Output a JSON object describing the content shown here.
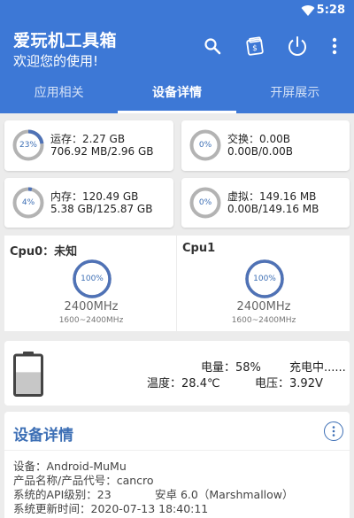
{
  "status_bar": {
    "time": "5:28",
    "wifi_icon": "wifi-icon"
  },
  "app_bar": {
    "title": "爱玩机工具箱",
    "subtitle": "欢迎您的使用!",
    "actions": [
      "search-icon",
      "cleanup-icon",
      "power-icon",
      "more-vert-icon"
    ]
  },
  "tabs": [
    {
      "label": "应用相关",
      "active": false
    },
    {
      "label": "设备详情",
      "active": true
    },
    {
      "label": "开屏展示",
      "active": false
    }
  ],
  "memory": {
    "ram": {
      "label": "运存：",
      "value": "2.27 GB",
      "detail": "706.92 MB/2.96 GB",
      "percent": 23,
      "percent_label": "23%"
    },
    "swap": {
      "label": "交换：",
      "value": "0.00B",
      "detail": "0.00B/0.00B",
      "percent": 0,
      "percent_label": "0%"
    },
    "storage": {
      "label": "内存：",
      "value": "120.49 GB",
      "detail": "5.38 GB/125.87 GB",
      "percent": 4,
      "percent_label": "4%"
    },
    "virtual": {
      "label": "虚拟：",
      "value": "149.16 MB",
      "detail": "0.00B/149.16 MB",
      "percent": 0,
      "percent_label": "0%"
    }
  },
  "cpus": [
    {
      "title": "Cpu0：未知",
      "percent": 100,
      "percent_label": "100%",
      "freq": "2400MHz",
      "range": "1600~2400MHz"
    },
    {
      "title": "Cpu1",
      "percent": 100,
      "percent_label": "100%",
      "freq": "2400MHz",
      "range": "1600~2400MHz"
    }
  ],
  "battery": {
    "level_fraction": 0.58,
    "level_label": "电量：",
    "level": "58%",
    "state": "充电中......",
    "temp_label": "温度：",
    "temp": "28.4℃",
    "voltage_label": "电压：",
    "voltage": "3.92V"
  },
  "details": {
    "title": "设备详情",
    "info_icon": "more-vert-circle-icon",
    "device": "设备：Android-MuMu",
    "product": "产品名称/产品代号：cancro",
    "api": "系统的API级别：23",
    "android": "安卓 6.0（Marshmallow）",
    "updated": "系统更新时间：2020-07-13 18:40:11"
  },
  "colors": {
    "primary": "#3d78d6",
    "ring_track": "#b3b3b3",
    "ring_fill": "#4f72b6",
    "text_accent": "#3d6fb5",
    "battery_fill": "#c7c7c7"
  }
}
